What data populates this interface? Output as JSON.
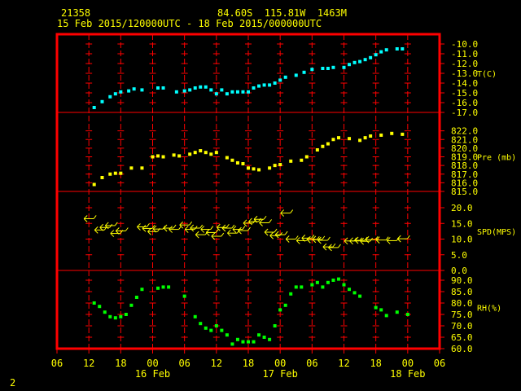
{
  "header": {
    "station": "21358",
    "location": "84.60S  115.81W  1463M",
    "period": "15 Feb 2015/120000UTC - 18 Feb 2015/000000UTC",
    "page_number": "2"
  },
  "colors": {
    "frame": "#ff0000",
    "grid": "#ff0000",
    "text": "#ffff00",
    "temp": "#00ffff",
    "pressure": "#ffff00",
    "wind": "#ffff00",
    "rh": "#00ff00"
  },
  "chart_data": {
    "type": "scatter",
    "x_axis": {
      "unit": "hours since 15 Feb 2015 00UTC",
      "range": [
        6,
        78
      ],
      "ticks": [
        {
          "hour": 6,
          "label": "06"
        },
        {
          "hour": 12,
          "label": "12"
        },
        {
          "hour": 18,
          "label": "18"
        },
        {
          "hour": 24,
          "label": "00"
        },
        {
          "hour": 30,
          "label": "06"
        },
        {
          "hour": 36,
          "label": "12"
        },
        {
          "hour": 42,
          "label": "18"
        },
        {
          "hour": 48,
          "label": "00"
        },
        {
          "hour": 54,
          "label": "06"
        },
        {
          "hour": 60,
          "label": "12"
        },
        {
          "hour": 66,
          "label": "18"
        },
        {
          "hour": 72,
          "label": "00"
        },
        {
          "hour": 78,
          "label": "06"
        }
      ],
      "date_labels": [
        {
          "hour": 24,
          "label": "16 Feb"
        },
        {
          "hour": 48,
          "label": "17 Feb"
        },
        {
          "hour": 72,
          "label": "18 Feb"
        }
      ]
    },
    "panels": [
      {
        "id": "temp",
        "label": "T(C)",
        "ylim": [
          -17,
          -10
        ],
        "yticks": [
          -10,
          -11,
          -12,
          -13,
          -14,
          -15,
          -16,
          -17
        ],
        "tick_labels": [
          "-10.0",
          "-11.0",
          "-12.0",
          "-13.0",
          "-14.0",
          "-15.0",
          "-16.0",
          "-17.0"
        ],
        "label_at": -13,
        "points": [
          [
            13,
            -16.5
          ],
          [
            14.5,
            -15.9
          ],
          [
            16,
            -15.4
          ],
          [
            17,
            -15.1
          ],
          [
            18,
            -14.9
          ],
          [
            19.5,
            -14.8
          ],
          [
            20.5,
            -14.6
          ],
          [
            22,
            -14.7
          ],
          [
            25,
            -14.5
          ],
          [
            26,
            -14.5
          ],
          [
            28.5,
            -14.9
          ],
          [
            30,
            -14.8
          ],
          [
            31,
            -14.7
          ],
          [
            32,
            -14.5
          ],
          [
            33,
            -14.4
          ],
          [
            34,
            -14.4
          ],
          [
            35,
            -14.7
          ],
          [
            36,
            -15.1
          ],
          [
            37,
            -14.7
          ],
          [
            38,
            -15.1
          ],
          [
            39,
            -14.9
          ],
          [
            40,
            -14.9
          ],
          [
            41,
            -14.9
          ],
          [
            42,
            -14.9
          ],
          [
            43,
            -14.5
          ],
          [
            44,
            -14.3
          ],
          [
            45,
            -14.2
          ],
          [
            46,
            -14.2
          ],
          [
            47,
            -14.0
          ],
          [
            48,
            -13.7
          ],
          [
            49,
            -13.4
          ],
          [
            51,
            -13.2
          ],
          [
            52.5,
            -12.9
          ],
          [
            54,
            -12.6
          ],
          [
            56,
            -12.5
          ],
          [
            57,
            -12.5
          ],
          [
            58,
            -12.4
          ],
          [
            60,
            -12.4
          ],
          [
            61,
            -12.1
          ],
          [
            62,
            -11.9
          ],
          [
            63,
            -11.8
          ],
          [
            64,
            -11.6
          ],
          [
            65,
            -11.4
          ],
          [
            66,
            -11.1
          ],
          [
            67,
            -10.8
          ],
          [
            68,
            -10.6
          ],
          [
            70,
            -10.5
          ],
          [
            71,
            -10.5
          ]
        ]
      },
      {
        "id": "pressure",
        "label": "Pre (mb)",
        "ylim": [
          815,
          823
        ],
        "yticks": [
          822,
          821,
          820,
          819,
          818,
          817,
          816,
          815
        ],
        "tick_labels": [
          "822.0",
          "821.0",
          "820.0",
          "819.0",
          "818.0",
          "817.0",
          "816.0",
          "815.0"
        ],
        "label_at": 819,
        "points": [
          [
            13,
            815.8
          ],
          [
            14.5,
            816.6
          ],
          [
            16,
            817.0
          ],
          [
            17,
            817.1
          ],
          [
            18,
            817.1
          ],
          [
            20,
            817.7
          ],
          [
            22,
            817.7
          ],
          [
            24,
            819.0
          ],
          [
            25,
            819.1
          ],
          [
            26,
            819.0
          ],
          [
            28,
            819.2
          ],
          [
            29,
            819.1
          ],
          [
            31,
            819.3
          ],
          [
            32,
            819.5
          ],
          [
            33,
            819.7
          ],
          [
            34,
            819.5
          ],
          [
            35,
            819.3
          ],
          [
            36,
            819.5
          ],
          [
            38,
            818.9
          ],
          [
            39,
            818.6
          ],
          [
            40,
            818.3
          ],
          [
            41,
            818.2
          ],
          [
            42,
            817.7
          ],
          [
            43,
            817.6
          ],
          [
            44,
            817.5
          ],
          [
            46,
            817.7
          ],
          [
            47,
            818.0
          ],
          [
            48,
            818.1
          ],
          [
            50,
            818.5
          ],
          [
            52,
            818.6
          ],
          [
            53,
            819.0
          ],
          [
            55,
            819.8
          ],
          [
            56,
            820.2
          ],
          [
            57,
            820.5
          ],
          [
            58,
            821.0
          ],
          [
            59,
            821.2
          ],
          [
            61,
            821.1
          ],
          [
            63,
            820.9
          ],
          [
            64,
            821.2
          ],
          [
            65,
            821.4
          ],
          [
            67,
            821.5
          ],
          [
            69,
            821.7
          ],
          [
            71,
            821.6
          ]
        ]
      },
      {
        "id": "wind",
        "label": "SPD(MPS)",
        "ylim": [
          0,
          20
        ],
        "yticks": [
          20,
          15,
          10,
          5,
          0
        ],
        "tick_labels": [
          "20.0",
          "15.0",
          "10.0",
          "5.0",
          "0.0"
        ],
        "label_at": 12.5,
        "points": [
          [
            12,
            16.5
          ],
          [
            14,
            12.9
          ],
          [
            15,
            13.7
          ],
          [
            16,
            14.3
          ],
          [
            17,
            11.8
          ],
          [
            18,
            12.6
          ],
          [
            22,
            13.9
          ],
          [
            23,
            13.4
          ],
          [
            24,
            12.4
          ],
          [
            25,
            13.2
          ],
          [
            27,
            13.5
          ],
          [
            28,
            13.1
          ],
          [
            30,
            14.5
          ],
          [
            31,
            13.1
          ],
          [
            32,
            13.5
          ],
          [
            33,
            11.4
          ],
          [
            34,
            13.1
          ],
          [
            35,
            12.1
          ],
          [
            36,
            10.9
          ],
          [
            37,
            13.7
          ],
          [
            38,
            13.5
          ],
          [
            39,
            11.9
          ],
          [
            40,
            13.1
          ],
          [
            41,
            12.7
          ],
          [
            42,
            15.1
          ],
          [
            43,
            15.6
          ],
          [
            44,
            16.3
          ],
          [
            45,
            15.2
          ],
          [
            46,
            12.2
          ],
          [
            47,
            11.1
          ],
          [
            48,
            11.4
          ],
          [
            49,
            18.3
          ],
          [
            50,
            10.0
          ],
          [
            52,
            9.5
          ],
          [
            53,
            10.3
          ],
          [
            54,
            9.8
          ],
          [
            55,
            9.9
          ],
          [
            56,
            9.6
          ],
          [
            57,
            7.5
          ],
          [
            58,
            7.3
          ],
          [
            61,
            9.4
          ],
          [
            62,
            9.4
          ],
          [
            63,
            9.6
          ],
          [
            64,
            9.3
          ],
          [
            65,
            9.8
          ],
          [
            67,
            9.7
          ],
          [
            69,
            9.5
          ],
          [
            71,
            10.1
          ]
        ]
      },
      {
        "id": "rh",
        "label": "RH(%)",
        "ylim": [
          60,
          90
        ],
        "yticks": [
          90,
          85,
          80,
          75,
          70,
          65,
          60
        ],
        "tick_labels": [
          "90.0",
          "85.0",
          "80.0",
          "75.0",
          "70.0",
          "65.0",
          "60.0"
        ],
        "label_at": 78,
        "points": [
          [
            13,
            80.0
          ],
          [
            14,
            78.5
          ],
          [
            15,
            76.0
          ],
          [
            16,
            74.0
          ],
          [
            17,
            73.5
          ],
          [
            18,
            74.0
          ],
          [
            19,
            75.0
          ],
          [
            20,
            79.0
          ],
          [
            21,
            82.5
          ],
          [
            22,
            86.0
          ],
          [
            25,
            86.5
          ],
          [
            26,
            87.0
          ],
          [
            27,
            87.0
          ],
          [
            30,
            83.0
          ],
          [
            32,
            74.0
          ],
          [
            33,
            71.0
          ],
          [
            34,
            69.0
          ],
          [
            35,
            68.0
          ],
          [
            36,
            70.0
          ],
          [
            37,
            68.0
          ],
          [
            38,
            66.0
          ],
          [
            39,
            62.0
          ],
          [
            40,
            64.0
          ],
          [
            41,
            63.0
          ],
          [
            42,
            63.0
          ],
          [
            43,
            63.0
          ],
          [
            44,
            66.0
          ],
          [
            45,
            65.0
          ],
          [
            46,
            64.0
          ],
          [
            47,
            70.0
          ],
          [
            48,
            77.0
          ],
          [
            49,
            79.0
          ],
          [
            50,
            84.0
          ],
          [
            51,
            87.0
          ],
          [
            52,
            87.0
          ],
          [
            54,
            88.0
          ],
          [
            55,
            89.0
          ],
          [
            56,
            87.0
          ],
          [
            57,
            89.0
          ],
          [
            58,
            90.0
          ],
          [
            59,
            90.5
          ],
          [
            60,
            88.0
          ],
          [
            61,
            86.0
          ],
          [
            62,
            84.5
          ],
          [
            63,
            83.0
          ],
          [
            66,
            78.0
          ],
          [
            67,
            77.0
          ],
          [
            68,
            74.5
          ],
          [
            70,
            76.0
          ],
          [
            72,
            75.0
          ]
        ]
      }
    ]
  }
}
